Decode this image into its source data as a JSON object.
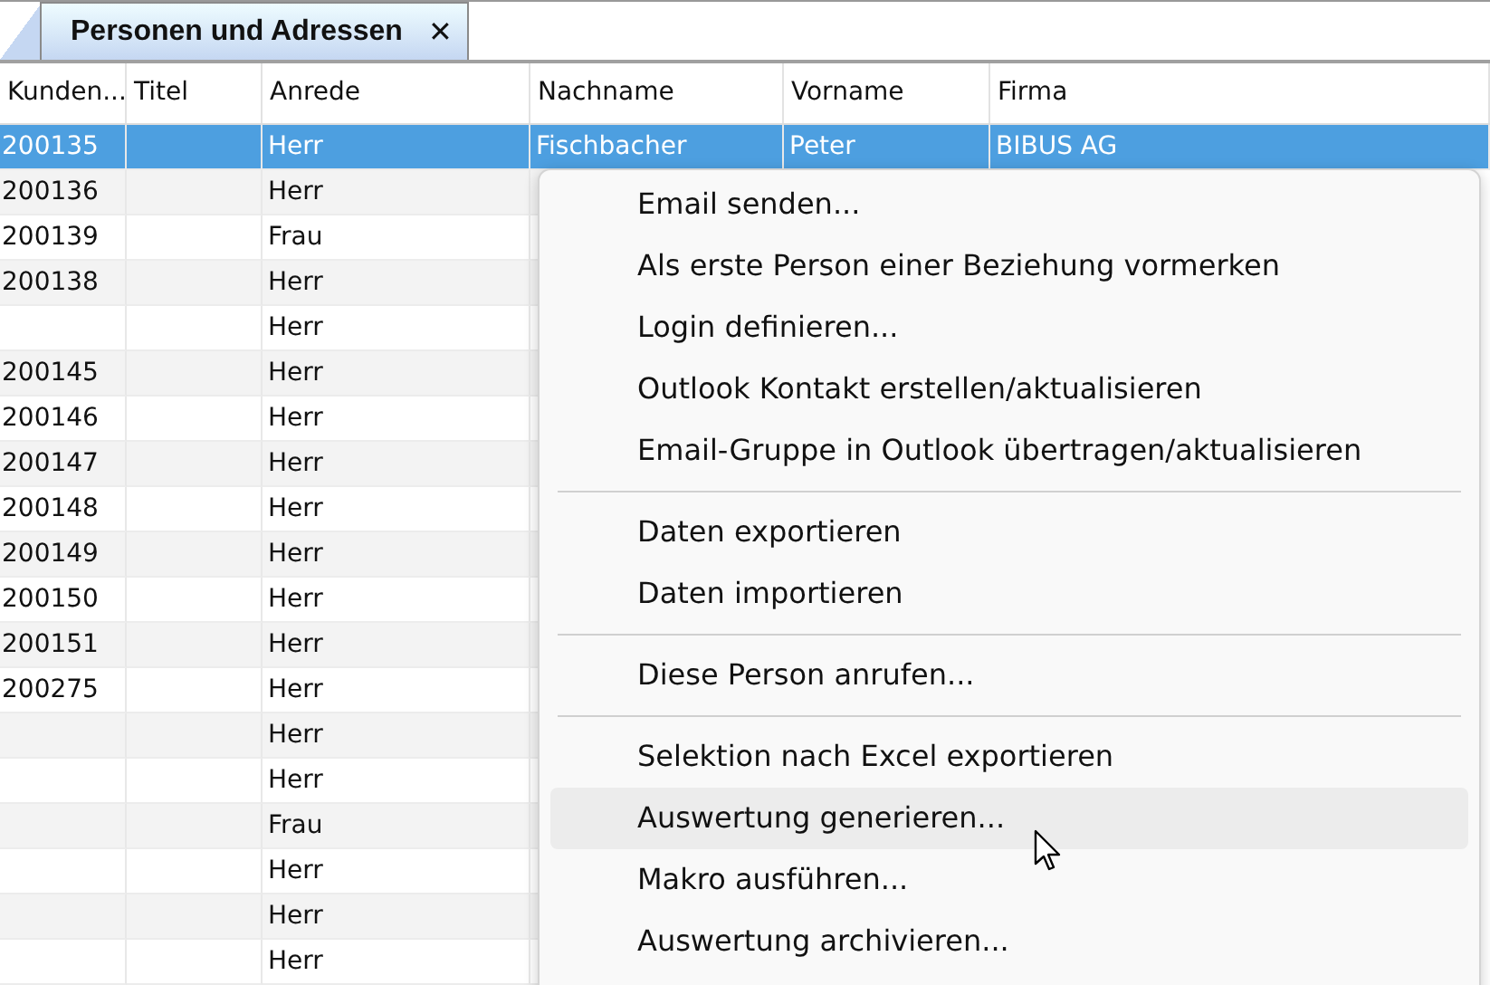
{
  "tabs": [
    {
      "label": "Personen und Adressen",
      "selected": true,
      "close": "✕"
    }
  ],
  "table": {
    "columns": [
      "Kunden...",
      "Titel",
      "Anrede",
      "Nachname",
      "Vorname",
      "Firma"
    ],
    "rows": [
      {
        "selected": true,
        "cells": [
          "200135",
          "",
          "Herr",
          "Fischbacher",
          "Peter",
          "BIBUS AG"
        ]
      },
      {
        "selected": false,
        "cells": [
          "200136",
          "",
          "Herr",
          ""
        ]
      },
      {
        "selected": false,
        "cells": [
          "200139",
          "",
          "Frau",
          ""
        ]
      },
      {
        "selected": false,
        "cells": [
          "200138",
          "",
          "Herr",
          ""
        ]
      },
      {
        "selected": false,
        "cells": [
          "",
          "",
          "Herr",
          ""
        ]
      },
      {
        "selected": false,
        "cells": [
          "200145",
          "",
          "Herr",
          ""
        ]
      },
      {
        "selected": false,
        "cells": [
          "200146",
          "",
          "Herr",
          ""
        ]
      },
      {
        "selected": false,
        "cells": [
          "200147",
          "",
          "Herr",
          ""
        ]
      },
      {
        "selected": false,
        "cells": [
          "200148",
          "",
          "Herr",
          ""
        ]
      },
      {
        "selected": false,
        "cells": [
          "200149",
          "",
          "Herr",
          ""
        ]
      },
      {
        "selected": false,
        "cells": [
          "200150",
          "",
          "Herr",
          ""
        ]
      },
      {
        "selected": false,
        "cells": [
          "200151",
          "",
          "Herr",
          ""
        ]
      },
      {
        "selected": false,
        "cells": [
          "200275",
          "",
          "Herr",
          ""
        ]
      },
      {
        "selected": false,
        "cells": [
          "",
          "",
          "Herr",
          ""
        ]
      },
      {
        "selected": false,
        "cells": [
          "",
          "",
          "Herr",
          ""
        ]
      },
      {
        "selected": false,
        "cells": [
          "",
          "",
          "Frau",
          ""
        ]
      },
      {
        "selected": false,
        "cells": [
          "",
          "",
          "Herr",
          ""
        ]
      },
      {
        "selected": false,
        "cells": [
          "",
          "",
          "Herr",
          ""
        ]
      },
      {
        "selected": false,
        "cells": [
          "",
          "",
          "Herr",
          ""
        ]
      }
    ]
  },
  "context_menu": {
    "items": [
      {
        "kind": "item",
        "label": "Email senden...",
        "hovered": false
      },
      {
        "kind": "item",
        "label": "Als erste Person einer Beziehung vormerken",
        "hovered": false
      },
      {
        "kind": "item",
        "label": "Login definieren...",
        "hovered": false
      },
      {
        "kind": "item",
        "label": "Outlook Kontakt erstellen/aktualisieren",
        "hovered": false
      },
      {
        "kind": "item",
        "label": "Email-Gruppe in Outlook übertragen/aktualisieren",
        "hovered": false
      },
      {
        "kind": "separator"
      },
      {
        "kind": "item",
        "label": "Daten exportieren",
        "hovered": false
      },
      {
        "kind": "item",
        "label": "Daten importieren",
        "hovered": false
      },
      {
        "kind": "separator"
      },
      {
        "kind": "item",
        "label": "Diese Person anrufen...",
        "hovered": false
      },
      {
        "kind": "separator"
      },
      {
        "kind": "item",
        "label": "Selektion nach Excel exportieren",
        "hovered": false
      },
      {
        "kind": "item",
        "label": "Auswertung generieren...",
        "hovered": true
      },
      {
        "kind": "item",
        "label": "Makro ausführen...",
        "hovered": false
      },
      {
        "kind": "item",
        "label": "Auswertung archivieren...",
        "hovered": false
      }
    ]
  }
}
